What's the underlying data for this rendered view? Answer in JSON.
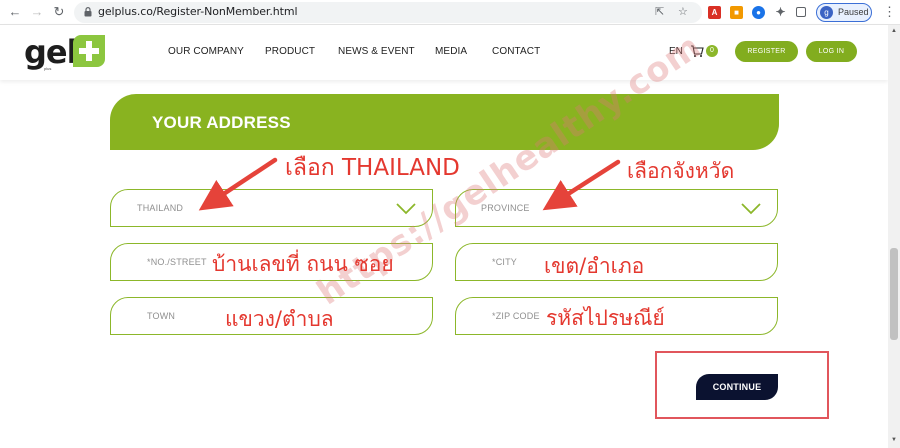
{
  "browser": {
    "url": "gelplus.co/Register-NonMember.html",
    "profile_label": "Paused",
    "profile_initial": "g"
  },
  "header": {
    "logo_text": "gel",
    "logo_sub": "plus",
    "menu": [
      "OUR COMPANY",
      "PRODUCT",
      "NEWS & EVENT",
      "MEDIA",
      "CONTACT"
    ],
    "lang": "EN",
    "cart_count": "0",
    "register_label": "REGISTER",
    "login_label": "LOG IN"
  },
  "form": {
    "section_title": "YOUR ADDRESS",
    "country_value": "THAILAND",
    "province_placeholder": "PROVINCE",
    "street_placeholder": "*NO./STREET",
    "city_placeholder": "*CITY",
    "town_placeholder": "TOWN",
    "zip_placeholder": "*ZIP CODE",
    "continue_label": "CONTINUE"
  },
  "annotations": {
    "country_hint": "เลือก THAILAND",
    "province_hint": "เลือกจังหวัด",
    "street_hint": "บ้านเลขที่ ถนน ซอย",
    "city_hint": "เขต/อำเภอ",
    "town_hint": "แขวง/ตำบล",
    "zip_hint": "รหัสไปรษณีย์",
    "watermark": "https://gelhealthy.com"
  },
  "colors": {
    "brand_green": "#89b320",
    "annotation_red": "#e4382f",
    "continue_navy": "#0b1230"
  }
}
